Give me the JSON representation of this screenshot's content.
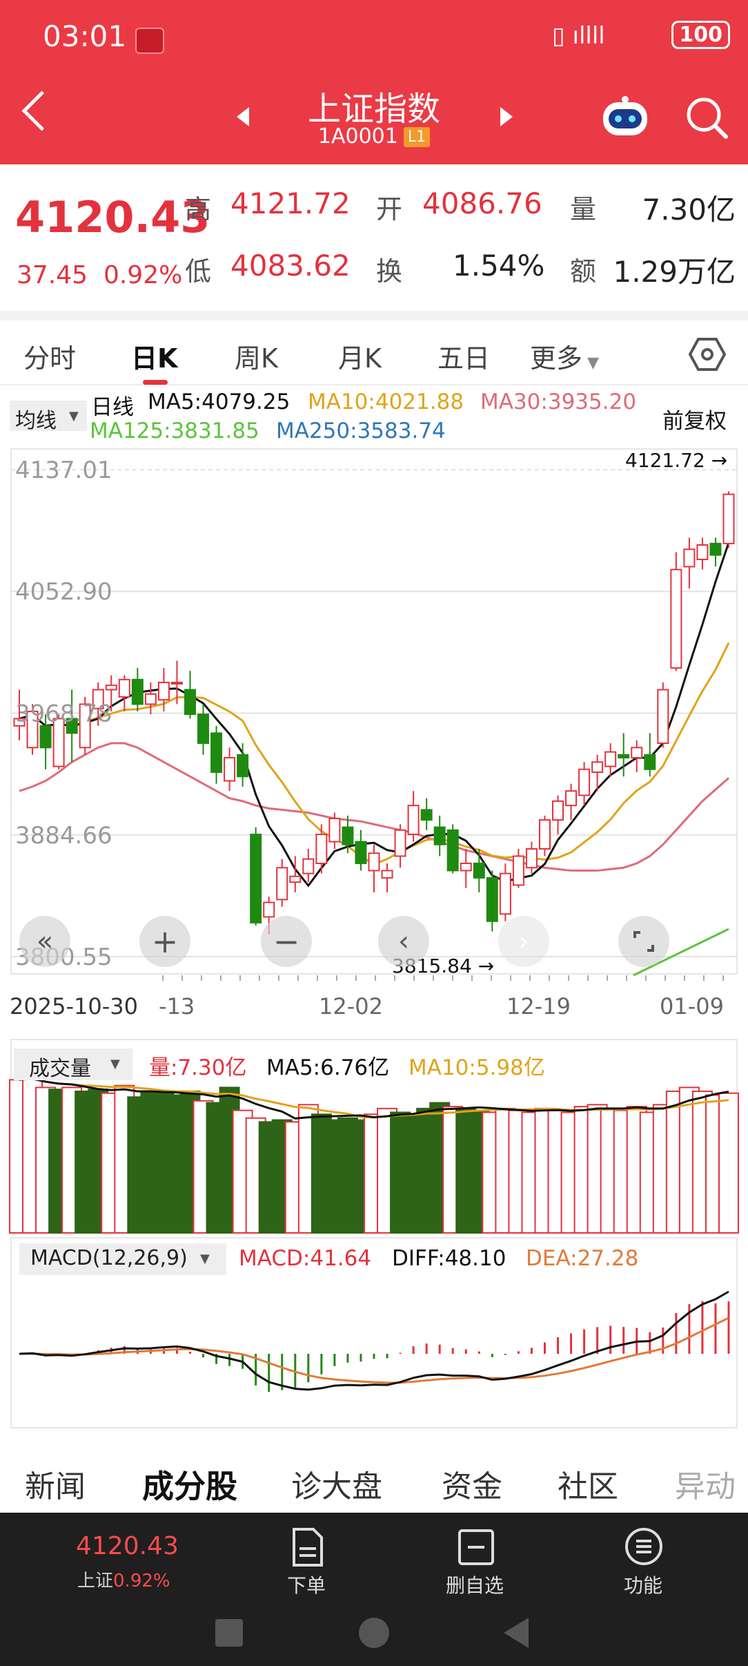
{
  "status_bar": {
    "time": "03:01",
    "battery": "100"
  },
  "header": {
    "title": "上证指数",
    "code": "1A0001",
    "level": "L1"
  },
  "quote": {
    "price": "4120.43",
    "change": "37.45",
    "change_pct": "0.92%",
    "high_label": "高",
    "high": "4121.72",
    "open_label": "开",
    "open": "4086.76",
    "vol_label": "量",
    "vol": "7.30亿",
    "low_label": "低",
    "low": "4083.62",
    "turnover_label": "换",
    "turnover": "1.54%",
    "amount_label": "额",
    "amount": "1.29万亿"
  },
  "tabs": [
    "分时",
    "日K",
    "周K",
    "月K",
    "五日",
    "更多"
  ],
  "legend": {
    "select": "均线",
    "kind": "日线",
    "ma5": "MA5:4079.25",
    "ma10": "MA10:4021.88",
    "ma30": "MA30:3935.20",
    "ma125": "MA125:3831.85",
    "ma250": "MA250:3583.74",
    "adjust": "前复权"
  },
  "colors": {
    "up": "#e3323d",
    "down": "#1f8a12",
    "ma5": "#111111",
    "ma10": "#e0a31a",
    "ma30": "#e06a78",
    "ma125": "#5cc43b",
    "ma250": "#2f77b8"
  },
  "chart_data": {
    "type": "candlestick",
    "y_axis_labels": [
      "4137.01",
      "4052.90",
      "3968.78",
      "3884.66",
      "3800.55"
    ],
    "ylim": [
      3800.55,
      4137.01
    ],
    "x_axis_labels": [
      "2025-10-30",
      "-13",
      "12-02",
      "12-19",
      "01-09"
    ],
    "max_marker": "4121.72",
    "min_marker": "3815.84",
    "candles": [
      [
        3960,
        3985,
        3950,
        3965
      ],
      [
        3945,
        3975,
        3940,
        3970
      ],
      [
        3960,
        3968,
        3930,
        3945
      ],
      [
        3932,
        3968,
        3930,
        3965
      ],
      [
        3965,
        3985,
        3935,
        3955
      ],
      [
        3945,
        3980,
        3940,
        3975
      ],
      [
        3972,
        3990,
        3960,
        3985
      ],
      [
        3985,
        3995,
        3970,
        3988
      ],
      [
        3980,
        3995,
        3970,
        3992
      ],
      [
        3992,
        4000,
        3970,
        3975
      ],
      [
        3975,
        3990,
        3968,
        3982
      ],
      [
        3978,
        4000,
        3970,
        3990
      ],
      [
        3990,
        4005,
        3975,
        3990
      ],
      [
        3985,
        3998,
        3965,
        3968
      ],
      [
        3968,
        3975,
        3940,
        3948
      ],
      [
        3955,
        3960,
        3920,
        3928
      ],
      [
        3922,
        3945,
        3915,
        3938
      ],
      [
        3940,
        3948,
        3918,
        3925
      ],
      [
        3885,
        3890,
        3822,
        3824
      ],
      [
        3828,
        3842,
        3816,
        3838
      ],
      [
        3840,
        3868,
        3835,
        3862
      ],
      [
        3852,
        3870,
        3845,
        3856
      ],
      [
        3858,
        3875,
        3852,
        3868
      ],
      [
        3865,
        3892,
        3858,
        3885
      ],
      [
        3880,
        3900,
        3875,
        3896
      ],
      [
        3890,
        3898,
        3872,
        3878
      ],
      [
        3880,
        3888,
        3860,
        3865
      ],
      [
        3860,
        3878,
        3845,
        3872
      ],
      [
        3855,
        3865,
        3845,
        3860
      ],
      [
        3870,
        3892,
        3862,
        3888
      ],
      [
        3885,
        3915,
        3880,
        3905
      ],
      [
        3902,
        3910,
        3888,
        3895
      ],
      [
        3890,
        3898,
        3870,
        3878
      ],
      [
        3888,
        3892,
        3858,
        3860
      ],
      [
        3860,
        3875,
        3848,
        3865
      ],
      [
        3865,
        3875,
        3845,
        3855
      ],
      [
        3855,
        3860,
        3818,
        3825
      ],
      [
        3830,
        3865,
        3825,
        3858
      ],
      [
        3850,
        3875,
        3848,
        3870
      ],
      [
        3862,
        3880,
        3858,
        3875
      ],
      [
        3875,
        3898,
        3870,
        3895
      ],
      [
        3895,
        3912,
        3885,
        3908
      ],
      [
        3905,
        3920,
        3895,
        3915
      ],
      [
        3912,
        3935,
        3905,
        3930
      ],
      [
        3928,
        3940,
        3915,
        3935
      ],
      [
        3932,
        3948,
        3925,
        3942
      ],
      [
        3940,
        3955,
        3925,
        3938
      ],
      [
        3938,
        3950,
        3928,
        3945
      ],
      [
        3940,
        3955,
        3925,
        3930
      ],
      [
        3948,
        3990,
        3945,
        3985
      ],
      [
        4000,
        4080,
        3998,
        4068
      ],
      [
        4070,
        4090,
        4055,
        4082
      ],
      [
        4075,
        4090,
        4068,
        4085
      ],
      [
        4086,
        4090,
        4070,
        4078
      ],
      [
        4086,
        4122,
        4083,
        4120
      ]
    ],
    "volume_legend": {
      "select": "成交量",
      "vol": "量:7.30亿",
      "ma5": "MA5:6.76亿",
      "ma10": "MA10:5.98亿"
    },
    "volume": [
      [
        1,
        8.0
      ],
      [
        1,
        8.1
      ],
      [
        1,
        7.6
      ],
      [
        0,
        7.5
      ],
      [
        1,
        7.6
      ],
      [
        0,
        7.4
      ],
      [
        0,
        7.5
      ],
      [
        1,
        7.3
      ],
      [
        1,
        7.7
      ],
      [
        0,
        7.1
      ],
      [
        0,
        7.4
      ],
      [
        0,
        7.3
      ],
      [
        0,
        7.2
      ],
      [
        0,
        7.4
      ],
      [
        1,
        6.9
      ],
      [
        0,
        6.8
      ],
      [
        0,
        7.6
      ],
      [
        1,
        6.4
      ],
      [
        1,
        6.0
      ],
      [
        0,
        5.8
      ],
      [
        0,
        5.9
      ],
      [
        1,
        5.8
      ],
      [
        1,
        6.7
      ],
      [
        0,
        6.2
      ],
      [
        0,
        5.9
      ],
      [
        0,
        6.0
      ],
      [
        0,
        5.9
      ],
      [
        1,
        6.2
      ],
      [
        1,
        6.5
      ],
      [
        0,
        6.3
      ],
      [
        0,
        6.2
      ],
      [
        0,
        6.5
      ],
      [
        0,
        6.8
      ],
      [
        1,
        6.6
      ],
      [
        0,
        6.5
      ],
      [
        0,
        6.4
      ],
      [
        1,
        6.3
      ],
      [
        1,
        6.5
      ],
      [
        1,
        6.4
      ],
      [
        1,
        6.3
      ],
      [
        1,
        6.5
      ],
      [
        1,
        6.4
      ],
      [
        1,
        6.3
      ],
      [
        1,
        6.6
      ],
      [
        1,
        6.7
      ],
      [
        1,
        6.5
      ],
      [
        1,
        6.4
      ],
      [
        1,
        6.6
      ],
      [
        1,
        6.3
      ],
      [
        1,
        6.7
      ],
      [
        1,
        7.4
      ],
      [
        1,
        7.6
      ],
      [
        1,
        7.4
      ],
      [
        1,
        7.2
      ],
      [
        1,
        7.3
      ]
    ],
    "macd_legend": {
      "select": "MACD(12,26,9)",
      "macd": "MACD:41.64",
      "diff": "DIFF:48.10",
      "dea": "DEA:27.28"
    }
  },
  "buttons": {
    "zoom_in": "+",
    "zoom_out": "−"
  },
  "bottom_tabs": [
    "新闻",
    "成分股",
    "诊大盘",
    "资金",
    "社区",
    "异动"
  ],
  "nav": {
    "mini_price": "4120.43",
    "mini_name": "上证",
    "mini_pct": "0.92%",
    "order": "下单",
    "remove": "删自选",
    "function": "功能"
  }
}
